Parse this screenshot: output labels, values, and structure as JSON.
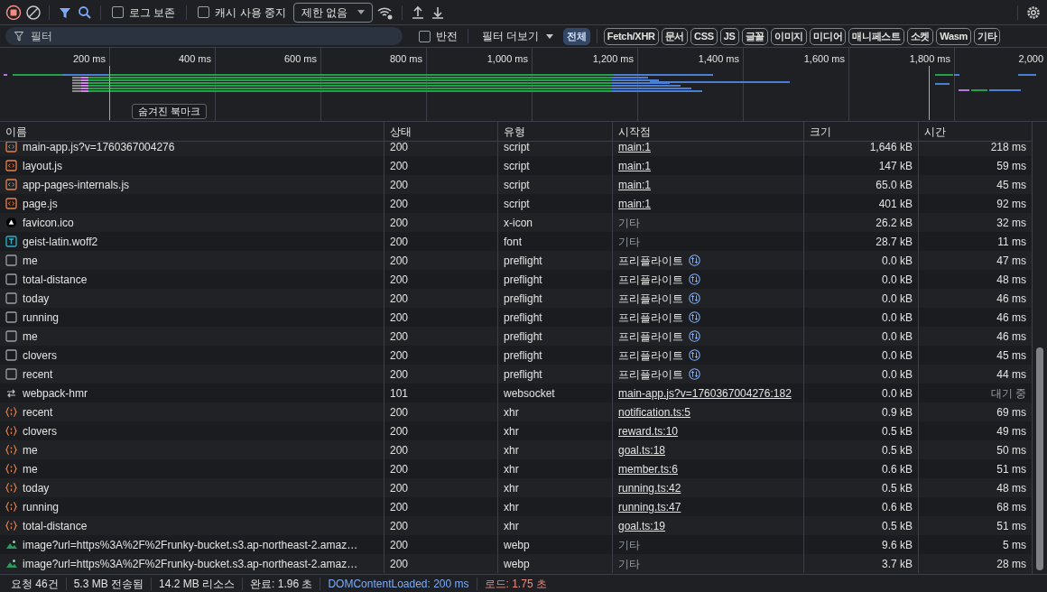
{
  "toolbar": {
    "record_on": true,
    "preserve_log": {
      "label": "로그 보존",
      "checked": false
    },
    "disable_cache": {
      "label": "캐시 사용 중지",
      "checked": false
    },
    "throttling": {
      "value": "제한 없음"
    }
  },
  "filter_bar": {
    "placeholder": "필터",
    "invert": {
      "label": "반전",
      "checked": false
    },
    "more_filters": "필터 더보기",
    "chips": [
      {
        "label": "전체",
        "selected": true
      },
      {
        "label": "Fetch/XHR",
        "selected": false
      },
      {
        "label": "문서",
        "selected": false
      },
      {
        "label": "CSS",
        "selected": false
      },
      {
        "label": "JS",
        "selected": false
      },
      {
        "label": "글꼴",
        "selected": false
      },
      {
        "label": "이미지",
        "selected": false
      },
      {
        "label": "미디어",
        "selected": false
      },
      {
        "label": "매니페스트",
        "selected": false
      },
      {
        "label": "소켓",
        "selected": false
      },
      {
        "label": "Wasm",
        "selected": false
      },
      {
        "label": "기타",
        "selected": false
      }
    ]
  },
  "timeline": {
    "ticks": [
      "200 ms",
      "400 ms",
      "600 ms",
      "800 ms",
      "1,000 ms",
      "1,200 ms",
      "1,400 ms",
      "1,600 ms",
      "1,800 ms",
      "2,000"
    ],
    "bookmark_tooltip": "숨겨진 북마크"
  },
  "table": {
    "columns": [
      "이름",
      "상태",
      "유형",
      "시작점",
      "크기",
      "시간"
    ],
    "rows": [
      {
        "kind": "script",
        "name": "main-app.js?v=1760367004276",
        "status": "200",
        "type": "script",
        "initiator": {
          "kind": "link",
          "text": "main:1"
        },
        "size": "1,646 kB",
        "time": "218 ms",
        "pending": false
      },
      {
        "kind": "script",
        "name": "layout.js",
        "status": "200",
        "type": "script",
        "initiator": {
          "kind": "link",
          "text": "main:1"
        },
        "size": "147 kB",
        "time": "59 ms",
        "pending": false
      },
      {
        "kind": "script",
        "name": "app-pages-internals.js",
        "status": "200",
        "type": "script",
        "initiator": {
          "kind": "link",
          "text": "main:1"
        },
        "size": "65.0 kB",
        "time": "45 ms",
        "pending": false
      },
      {
        "kind": "script",
        "name": "page.js",
        "status": "200",
        "type": "script",
        "initiator": {
          "kind": "link",
          "text": "main:1"
        },
        "size": "401 kB",
        "time": "92 ms",
        "pending": false
      },
      {
        "kind": "favicon",
        "name": "favicon.ico",
        "status": "200",
        "type": "x-icon",
        "initiator": {
          "kind": "other",
          "text": "기타"
        },
        "size": "26.2 kB",
        "time": "32 ms",
        "pending": false
      },
      {
        "kind": "font",
        "name": "geist-latin.woff2",
        "status": "200",
        "type": "font",
        "initiator": {
          "kind": "other",
          "text": "기타"
        },
        "size": "28.7 kB",
        "time": "11 ms",
        "pending": false
      },
      {
        "kind": "preflight",
        "name": "me",
        "status": "200",
        "type": "preflight",
        "initiator": {
          "kind": "preflight",
          "text": "프리플라이트"
        },
        "size": "0.0 kB",
        "time": "47 ms",
        "pending": false
      },
      {
        "kind": "preflight",
        "name": "total-distance",
        "status": "200",
        "type": "preflight",
        "initiator": {
          "kind": "preflight",
          "text": "프리플라이트"
        },
        "size": "0.0 kB",
        "time": "48 ms",
        "pending": false
      },
      {
        "kind": "preflight",
        "name": "today",
        "status": "200",
        "type": "preflight",
        "initiator": {
          "kind": "preflight",
          "text": "프리플라이트"
        },
        "size": "0.0 kB",
        "time": "46 ms",
        "pending": false
      },
      {
        "kind": "preflight",
        "name": "running",
        "status": "200",
        "type": "preflight",
        "initiator": {
          "kind": "preflight",
          "text": "프리플라이트"
        },
        "size": "0.0 kB",
        "time": "46 ms",
        "pending": false
      },
      {
        "kind": "preflight",
        "name": "me",
        "status": "200",
        "type": "preflight",
        "initiator": {
          "kind": "preflight",
          "text": "프리플라이트"
        },
        "size": "0.0 kB",
        "time": "46 ms",
        "pending": false
      },
      {
        "kind": "preflight",
        "name": "clovers",
        "status": "200",
        "type": "preflight",
        "initiator": {
          "kind": "preflight",
          "text": "프리플라이트"
        },
        "size": "0.0 kB",
        "time": "45 ms",
        "pending": false
      },
      {
        "kind": "preflight",
        "name": "recent",
        "status": "200",
        "type": "preflight",
        "initiator": {
          "kind": "preflight",
          "text": "프리플라이트"
        },
        "size": "0.0 kB",
        "time": "44 ms",
        "pending": false
      },
      {
        "kind": "websocket",
        "name": "webpack-hmr",
        "status": "101",
        "type": "websocket",
        "initiator": {
          "kind": "link",
          "text": "main-app.js?v=1760367004276:182"
        },
        "size": "0.0 kB",
        "time": "대기 중",
        "pending": true
      },
      {
        "kind": "xhr",
        "name": "recent",
        "status": "200",
        "type": "xhr",
        "initiator": {
          "kind": "link",
          "text": "notification.ts:5"
        },
        "size": "0.9 kB",
        "time": "69 ms",
        "pending": false
      },
      {
        "kind": "xhr",
        "name": "clovers",
        "status": "200",
        "type": "xhr",
        "initiator": {
          "kind": "link",
          "text": "reward.ts:10"
        },
        "size": "0.5 kB",
        "time": "49 ms",
        "pending": false
      },
      {
        "kind": "xhr",
        "name": "me",
        "status": "200",
        "type": "xhr",
        "initiator": {
          "kind": "link",
          "text": "goal.ts:18"
        },
        "size": "0.5 kB",
        "time": "50 ms",
        "pending": false
      },
      {
        "kind": "xhr",
        "name": "me",
        "status": "200",
        "type": "xhr",
        "initiator": {
          "kind": "link",
          "text": "member.ts:6"
        },
        "size": "0.6 kB",
        "time": "51 ms",
        "pending": false
      },
      {
        "kind": "xhr",
        "name": "today",
        "status": "200",
        "type": "xhr",
        "initiator": {
          "kind": "link",
          "text": "running.ts:42"
        },
        "size": "0.5 kB",
        "time": "48 ms",
        "pending": false
      },
      {
        "kind": "xhr",
        "name": "running",
        "status": "200",
        "type": "xhr",
        "initiator": {
          "kind": "link",
          "text": "running.ts:47"
        },
        "size": "0.6 kB",
        "time": "68 ms",
        "pending": false
      },
      {
        "kind": "xhr",
        "name": "total-distance",
        "status": "200",
        "type": "xhr",
        "initiator": {
          "kind": "link",
          "text": "goal.ts:19"
        },
        "size": "0.5 kB",
        "time": "51 ms",
        "pending": false
      },
      {
        "kind": "image",
        "name": "image?url=https%3A%2F%2Frunky-bucket.s3.ap-northeast-2.amaz…",
        "status": "200",
        "type": "webp",
        "initiator": {
          "kind": "other",
          "text": "기타"
        },
        "size": "9.6 kB",
        "time": "5 ms",
        "pending": false
      },
      {
        "kind": "image",
        "name": "image?url=https%3A%2F%2Frunky-bucket.s3.ap-northeast-2.amaz…",
        "status": "200",
        "type": "webp",
        "initiator": {
          "kind": "other",
          "text": "기타"
        },
        "size": "3.7 kB",
        "time": "28 ms",
        "pending": false
      }
    ]
  },
  "status_bar": [
    {
      "text": "요청 46건",
      "kind": "plain"
    },
    {
      "text": "5.3 MB 전송됨",
      "kind": "plain"
    },
    {
      "text": "14.2 MB 리소스",
      "kind": "plain"
    },
    {
      "text": "완료: 1.96 초",
      "kind": "plain"
    },
    {
      "text": "DOMContentLoaded: 200 ms",
      "kind": "dom"
    },
    {
      "text": "로드: 1.75 초",
      "kind": "load"
    }
  ]
}
